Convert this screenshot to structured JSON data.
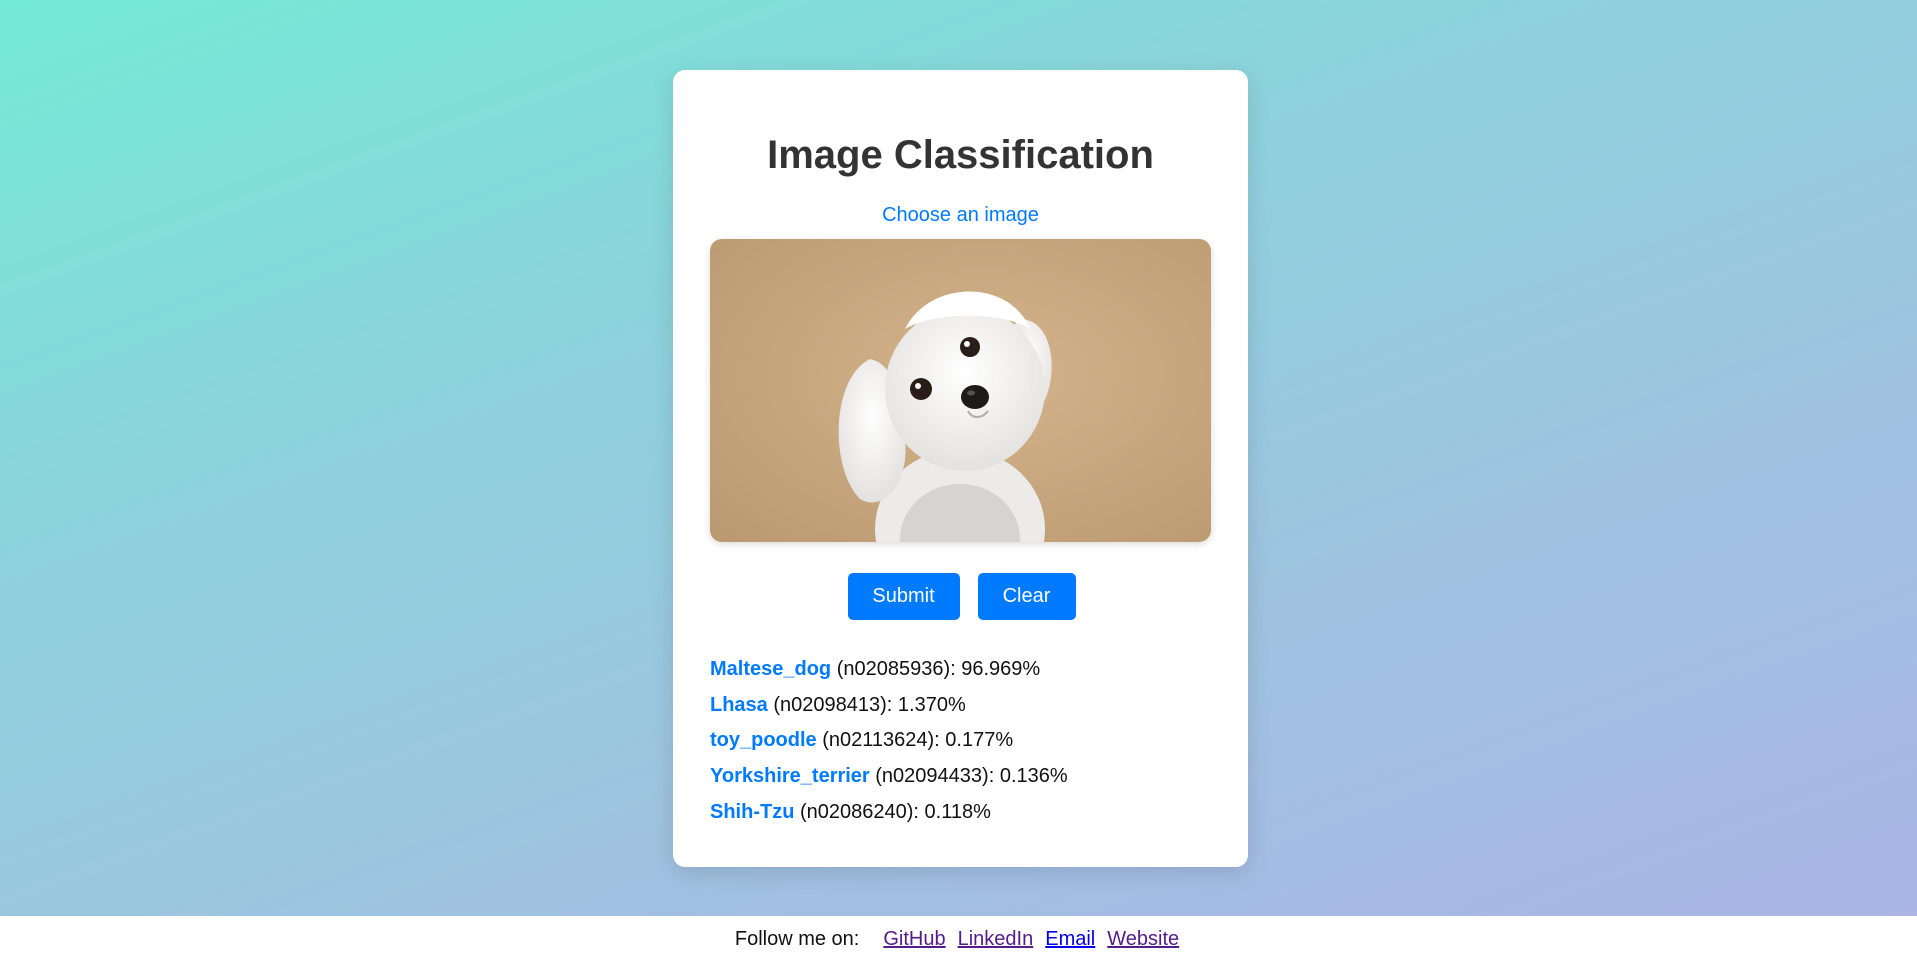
{
  "page": {
    "title": "Image Classification",
    "choose_label": "Choose an image",
    "preview_alt": "Preview image"
  },
  "buttons": {
    "submit_label": "Submit",
    "clear_label": "Clear"
  },
  "results": [
    {
      "label": "Maltese_dog",
      "detail": " (n02085936): 96.969%"
    },
    {
      "label": "Lhasa",
      "detail": " (n02098413): 1.370%"
    },
    {
      "label": "toy_poodle",
      "detail": " (n02113624): 0.177%"
    },
    {
      "label": "Yorkshire_terrier",
      "detail": " (n02094433): 0.136%"
    },
    {
      "label": "Shih-Tzu",
      "detail": " (n02086240): 0.118%"
    }
  ],
  "footer": {
    "follow_text": "Follow me on:",
    "links": [
      "GitHub",
      "LinkedIn",
      "Email",
      "Website"
    ]
  },
  "colors": {
    "accent": "#007bff",
    "title": "#333333",
    "visited_link": "#551a8b",
    "link": "#0000ee"
  }
}
